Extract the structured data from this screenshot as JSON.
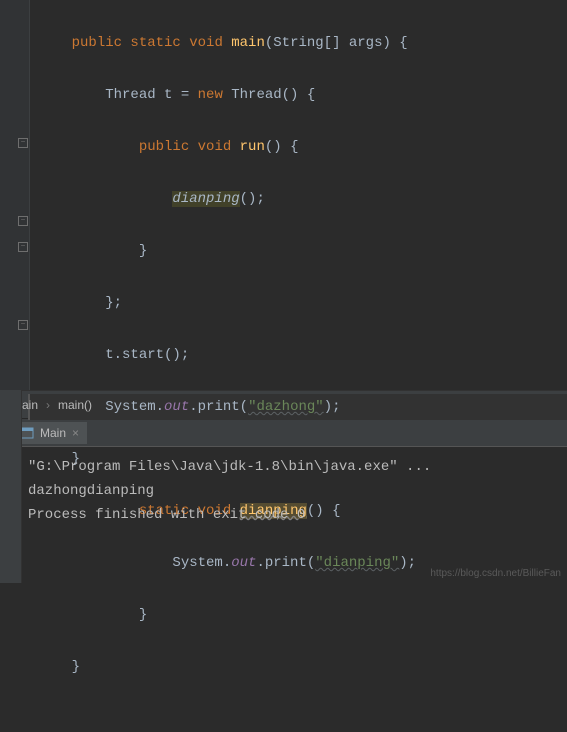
{
  "code": {
    "l0_kw1": "public static ",
    "l0_kw2": "void ",
    "l0_method": "main",
    "l0_rest": "(String[] args) {",
    "l1_a": "Thread t = ",
    "l1_b": "new ",
    "l1_c": "Thread() {",
    "l2_a": "public void ",
    "l2_b": "run",
    "l2_c": "() {",
    "l3_a": "dianping",
    "l3_b": "();",
    "l4": "}",
    "l5": "};",
    "l6": "t.start();",
    "l7_a": "System.",
    "l7_b": "out",
    "l7_c": ".print(",
    "l7_d": "\"dazhong\"",
    "l7_e": ");",
    "l8": "}",
    "l9_a": "static void ",
    "l9_b": "dianping",
    "l9_c": "() {",
    "l10_a": "System.",
    "l10_b": "out",
    "l10_c": ".print(",
    "l10_d": "\"dianping\"",
    "l10_e": ");",
    "l11": "}",
    "l12": "}"
  },
  "breadcrumb": {
    "item1": "Main",
    "item2": "main()"
  },
  "runTab": {
    "name": "Main"
  },
  "console": {
    "line1": "\"G:\\Program Files\\Java\\jdk-1.8\\bin\\java.exe\" ...",
    "line2": "dazhongdianping",
    "line3": "Process finished with exit code 0"
  },
  "watermark": "https://blog.csdn.net/BillieFan"
}
